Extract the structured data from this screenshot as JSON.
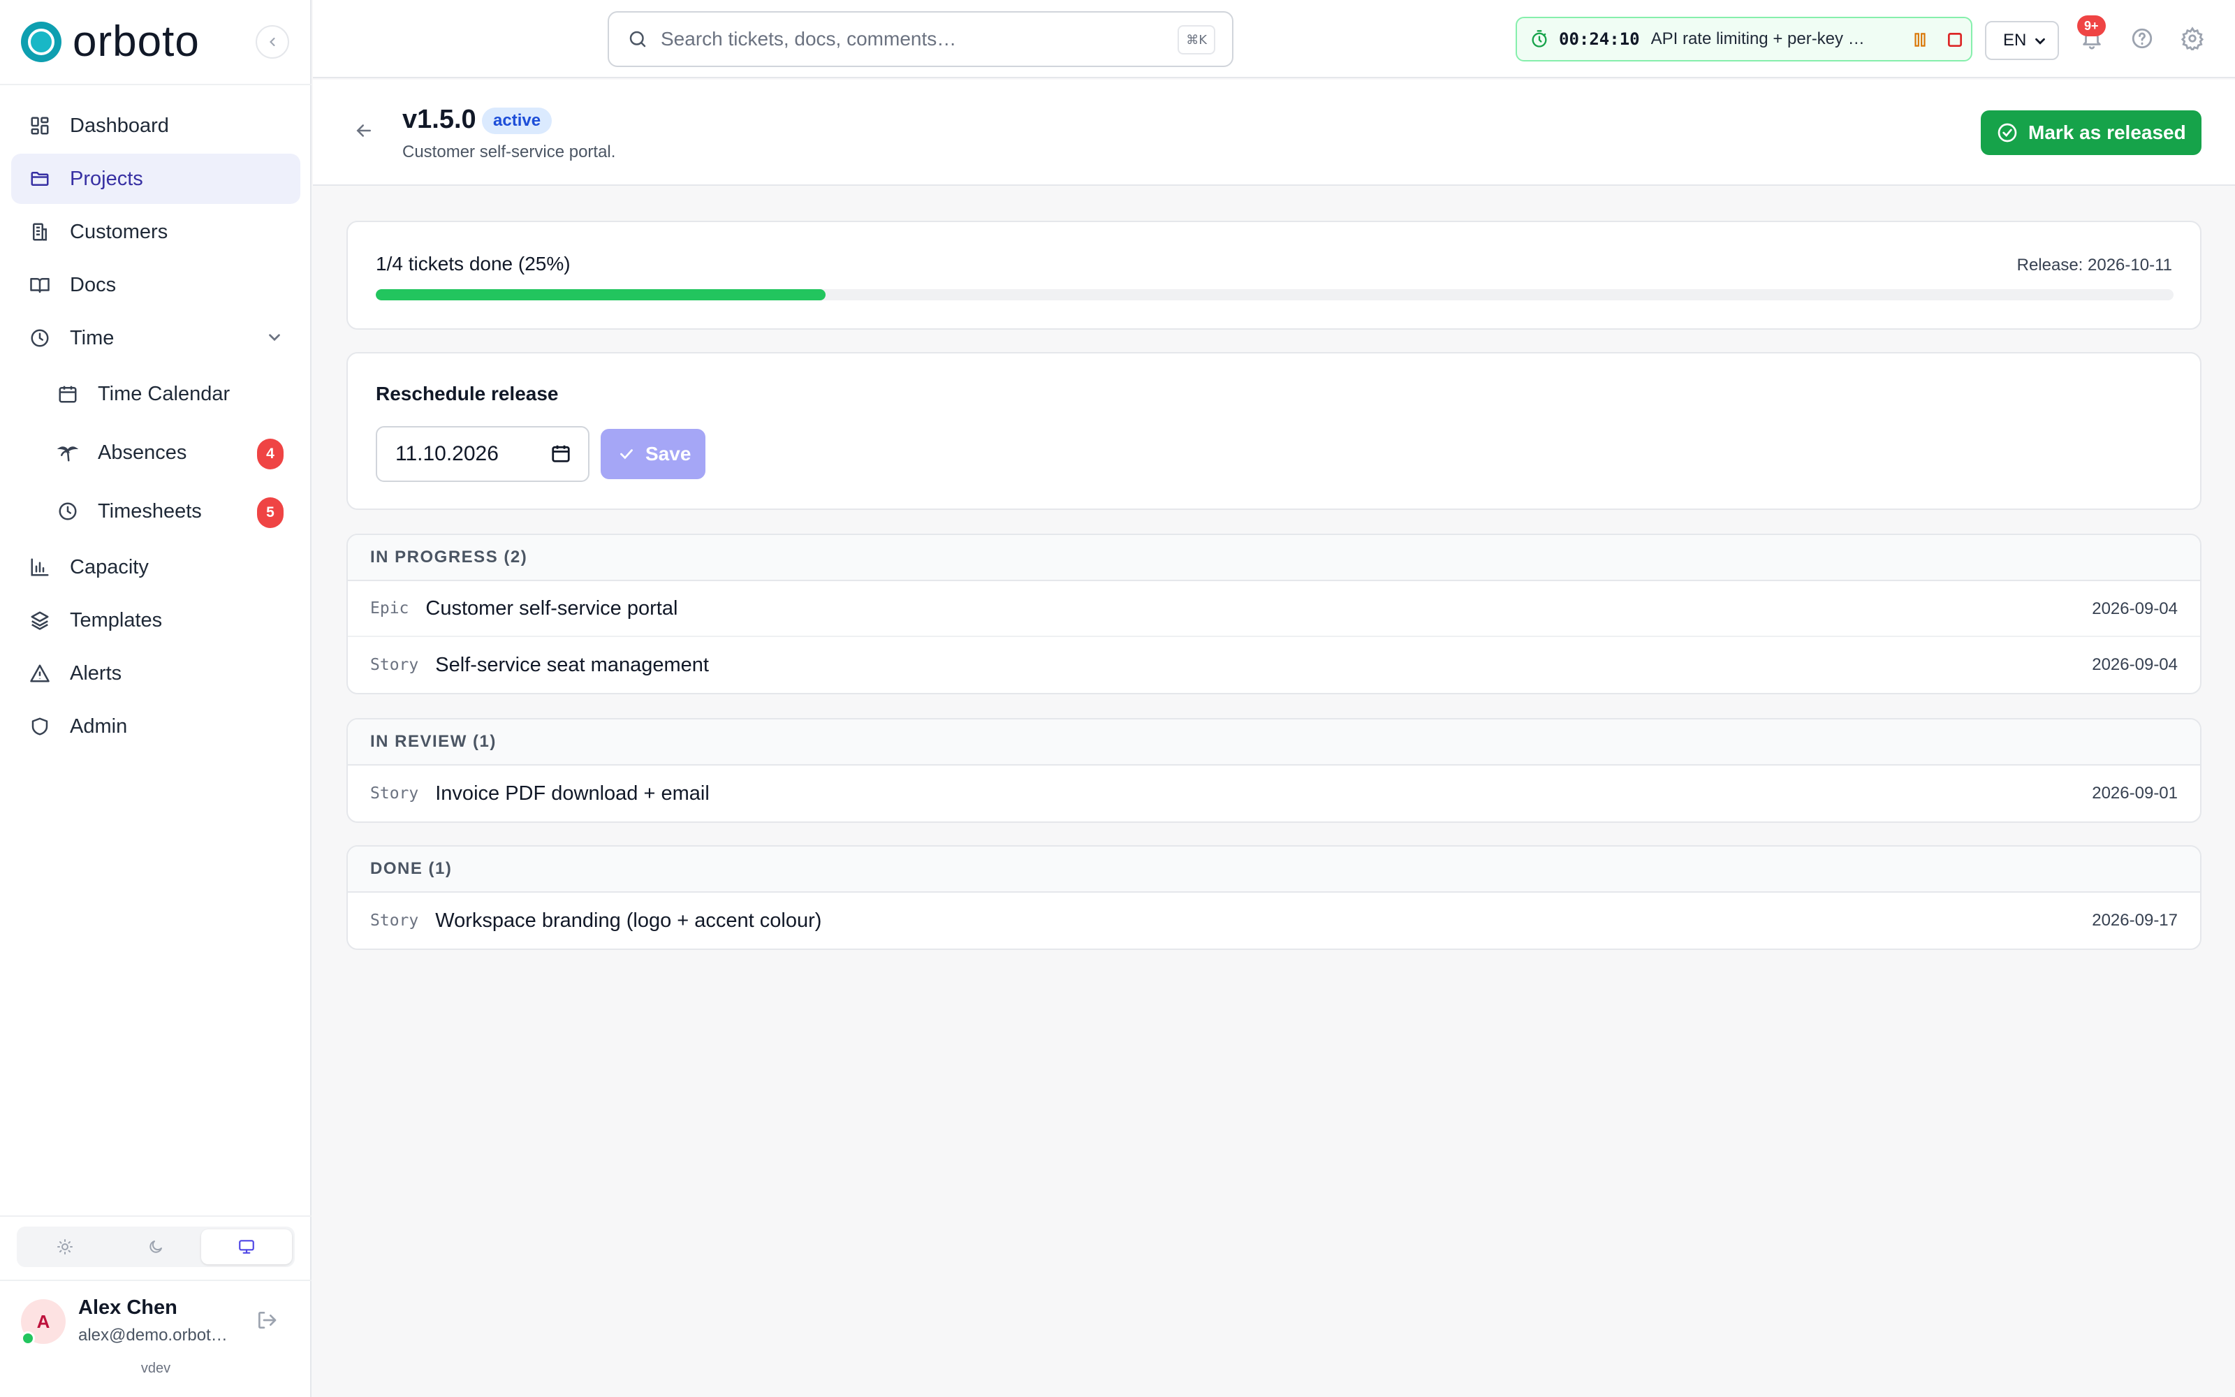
{
  "app": {
    "name": "orboto",
    "version": "vdev"
  },
  "colors": {
    "brand": "#19b7c6",
    "accent": "#3730a3",
    "success": "#16a34a",
    "progress": "#22c55e",
    "danger": "#ef4444"
  },
  "sidebar": {
    "items": [
      {
        "label": "Dashboard",
        "icon": "dashboard-icon",
        "active": false
      },
      {
        "label": "Projects",
        "icon": "folder-icon",
        "active": true
      },
      {
        "label": "Customers",
        "icon": "building-icon",
        "active": false
      },
      {
        "label": "Docs",
        "icon": "book-icon",
        "active": false
      },
      {
        "label": "Time",
        "icon": "clock-icon",
        "active": false,
        "expanded": true,
        "children": [
          {
            "label": "Time Calendar",
            "icon": "calendar-icon"
          },
          {
            "label": "Absences",
            "icon": "palm-tree-icon",
            "badge": "4"
          },
          {
            "label": "Timesheets",
            "icon": "clock-icon",
            "badge": "5"
          }
        ]
      },
      {
        "label": "Capacity",
        "icon": "bar-chart-icon",
        "active": false
      },
      {
        "label": "Templates",
        "icon": "layers-icon",
        "active": false
      },
      {
        "label": "Alerts",
        "icon": "warning-icon",
        "active": false
      },
      {
        "label": "Admin",
        "icon": "shield-icon",
        "active": false
      }
    ],
    "theme_options": [
      "light",
      "dark",
      "system"
    ],
    "theme_selected": "system",
    "user": {
      "initial": "A",
      "name": "Alex Chen",
      "email": "alex@demo.orbot…"
    }
  },
  "topbar": {
    "search": {
      "placeholder": "Search tickets, docs, comments…",
      "shortcut": "⌘K"
    },
    "timer": {
      "time": "00:24:10",
      "task": "API rate limiting + per-key …"
    },
    "language": "EN",
    "notifications_badge": "9+"
  },
  "release": {
    "version": "v1.5.0",
    "status": "active",
    "description": "Customer self-service portal.",
    "mark_released_label": "Mark as released",
    "progress_text": "1/4 tickets done (25%)",
    "progress_fraction": 0.25,
    "release_date_text": "Release: 2026-10-11"
  },
  "reschedule": {
    "title": "Reschedule release",
    "date_value": "11.10.2026",
    "save_label": "Save"
  },
  "groups": [
    {
      "title": "IN PROGRESS (2)",
      "tickets": [
        {
          "type": "Epic",
          "name": "Customer self-service portal",
          "date": "2026-09-04"
        },
        {
          "type": "Story",
          "name": "Self-service seat management",
          "date": "2026-09-04"
        }
      ]
    },
    {
      "title": "IN REVIEW (1)",
      "tickets": [
        {
          "type": "Story",
          "name": "Invoice PDF download + email",
          "date": "2026-09-01"
        }
      ]
    },
    {
      "title": "DONE (1)",
      "tickets": [
        {
          "type": "Story",
          "name": "Workspace branding (logo + accent colour)",
          "date": "2026-09-17"
        }
      ]
    }
  ]
}
